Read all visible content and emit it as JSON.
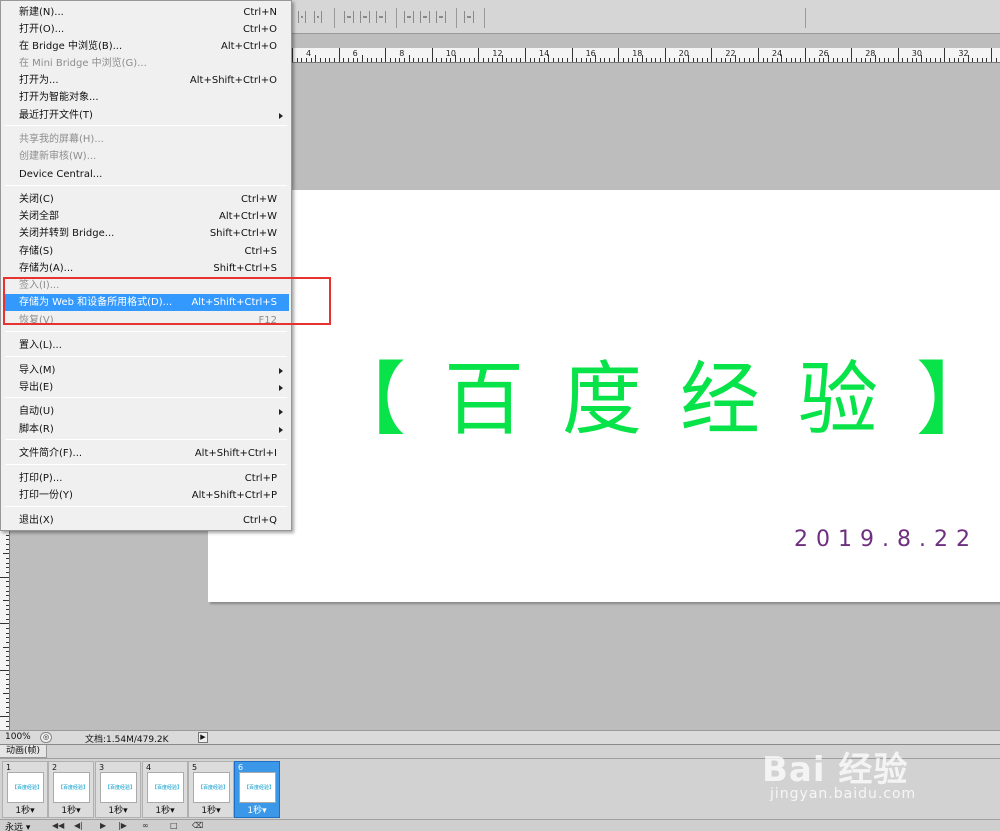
{
  "menu": {
    "items": [
      {
        "label": "新建(N)...",
        "shortcut": "Ctrl+N"
      },
      {
        "label": "打开(O)...",
        "shortcut": "Ctrl+O"
      },
      {
        "label": "在 Bridge 中浏览(B)...",
        "shortcut": "Alt+Ctrl+O"
      },
      {
        "label": "在 Mini Bridge 中浏览(G)...",
        "shortcut": ""
      },
      {
        "label": "打开为...",
        "shortcut": "Alt+Shift+Ctrl+O"
      },
      {
        "label": "打开为智能对象...",
        "shortcut": ""
      },
      {
        "label": "最近打开文件(T)",
        "shortcut": ""
      },
      {
        "label": "共享我的屏幕(H)...",
        "shortcut": ""
      },
      {
        "label": "创建新审核(W)...",
        "shortcut": ""
      },
      {
        "label": "Device Central...",
        "shortcut": ""
      },
      {
        "label": "关闭(C)",
        "shortcut": "Ctrl+W"
      },
      {
        "label": "关闭全部",
        "shortcut": "Alt+Ctrl+W"
      },
      {
        "label": "关闭并转到 Bridge...",
        "shortcut": "Shift+Ctrl+W"
      },
      {
        "label": "存储(S)",
        "shortcut": "Ctrl+S"
      },
      {
        "label": "存储为(A)...",
        "shortcut": "Shift+Ctrl+S"
      },
      {
        "label": "签入(I)...",
        "shortcut": ""
      },
      {
        "label": "存储为 Web 和设备所用格式(D)...",
        "shortcut": "Alt+Shift+Ctrl+S"
      },
      {
        "label": "恢复(V)",
        "shortcut": "F12"
      },
      {
        "label": "置入(L)...",
        "shortcut": ""
      },
      {
        "label": "导入(M)",
        "shortcut": ""
      },
      {
        "label": "导出(E)",
        "shortcut": ""
      },
      {
        "label": "自动(U)",
        "shortcut": ""
      },
      {
        "label": "脚本(R)",
        "shortcut": ""
      },
      {
        "label": "文件简介(F)...",
        "shortcut": "Alt+Shift+Ctrl+I"
      },
      {
        "label": "打印(P)...",
        "shortcut": "Ctrl+P"
      },
      {
        "label": "打印一份(Y)",
        "shortcut": "Alt+Shift+Ctrl+P"
      },
      {
        "label": "退出(X)",
        "shortcut": "Ctrl+Q"
      }
    ]
  },
  "ruler": {
    "top_numbers": [
      "4",
      "6",
      "8",
      "10",
      "12",
      "14",
      "16",
      "18",
      "20",
      "22",
      "24",
      "26",
      "28",
      "30",
      "32"
    ]
  },
  "canvas": {
    "title": "【百度经验】",
    "date": "2019.8.22",
    "title_color": "#09e34a",
    "date_color": "#6e2f7e"
  },
  "status": {
    "zoom": "100%",
    "doc": "文档:1.54M/479.2K"
  },
  "animation": {
    "tab_label": "动画(帧)",
    "loop": "永远",
    "frames": [
      {
        "num": "1",
        "delay": "1秒"
      },
      {
        "num": "2",
        "delay": "1秒"
      },
      {
        "num": "3",
        "delay": "1秒"
      },
      {
        "num": "4",
        "delay": "1秒"
      },
      {
        "num": "5",
        "delay": "1秒"
      },
      {
        "num": "6",
        "delay": "1秒"
      }
    ],
    "thumb_text": "【百度经验】"
  },
  "watermark": {
    "main": "Bai 经验",
    "sub": "jingyan.baidu.com"
  },
  "colors": {
    "menu_highlight": "#3399ff",
    "annotation": "#e8322f",
    "frame_selected": "#3b97e7"
  }
}
